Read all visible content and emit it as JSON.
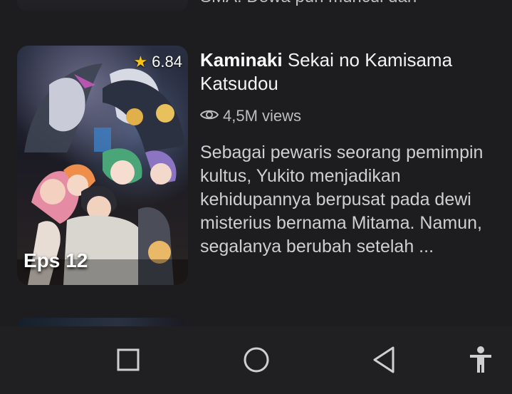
{
  "previous_item": {
    "synopsis_tail": "SMA. Dewa pun muncul dan"
  },
  "item": {
    "rating": "6.84",
    "episode_badge": "Eps 12",
    "title_bold": "Kaminaki",
    "title_rest": " Sekai no Kamisama Katsudou",
    "views": "4,5M views",
    "synopsis": "Sebagai pewaris seorang pemimpin kultus, Yukito menjadikan kehidupannya berpusat pada dewi misterius bernama Mitama. Namun, segalanya berubah setelah ..."
  },
  "icons": {
    "rating": "star-icon",
    "views": "eye-icon",
    "nav_recents": "square-icon",
    "nav_home": "circle-icon",
    "nav_back": "triangle-back-icon",
    "nav_accessibility": "accessibility-icon"
  },
  "colors": {
    "background": "#1d1d1f",
    "star": "#f5c518",
    "navbar": "#202022"
  }
}
